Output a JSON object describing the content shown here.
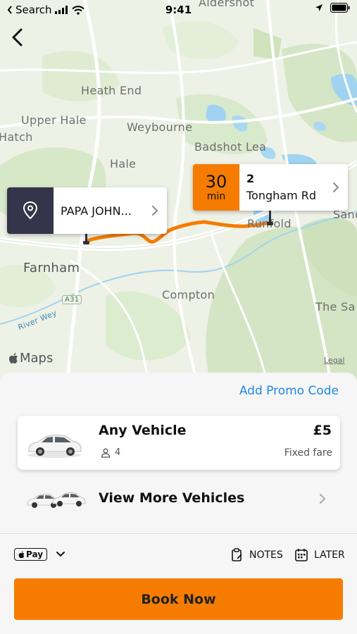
{
  "status_bar": {
    "back_app": "Search",
    "time": "9:41"
  },
  "map": {
    "places": {
      "aldershot": "Aldershot",
      "heath_end": "Heath End",
      "upper_hale": "Upper Hale",
      "hatch": "Hatch",
      "weybourne": "Weybourne",
      "badshot_lea": "Badshot Lea",
      "hale": "Hale",
      "runfold": "Runfold",
      "sands": "Sand",
      "farnham": "Farnham",
      "compton": "Compton",
      "the_sands": "The Sa",
      "river_wey": "River Wey",
      "road_a31": "A31"
    },
    "pickup": {
      "label": "PAPA JOHN..."
    },
    "dropoff": {
      "eta_value": "30",
      "eta_unit": "min",
      "number": "2",
      "street": "Tongham Rd"
    },
    "maps_brand": "Maps",
    "legal": "Legal",
    "route_color": "#f57c00"
  },
  "sheet": {
    "promo": "Add Promo Code",
    "vehicle": {
      "name": "Any Vehicle",
      "seats": "4",
      "price": "£5",
      "fare_type": "Fixed fare"
    },
    "more_vehicles": "View More Vehicles",
    "payment": {
      "method": "Pay"
    },
    "notes": "NOTES",
    "later": "LATER",
    "book": "Book Now"
  },
  "colors": {
    "accent": "#f57c00",
    "link": "#1e88e5",
    "pin_dark": "#34344a"
  }
}
